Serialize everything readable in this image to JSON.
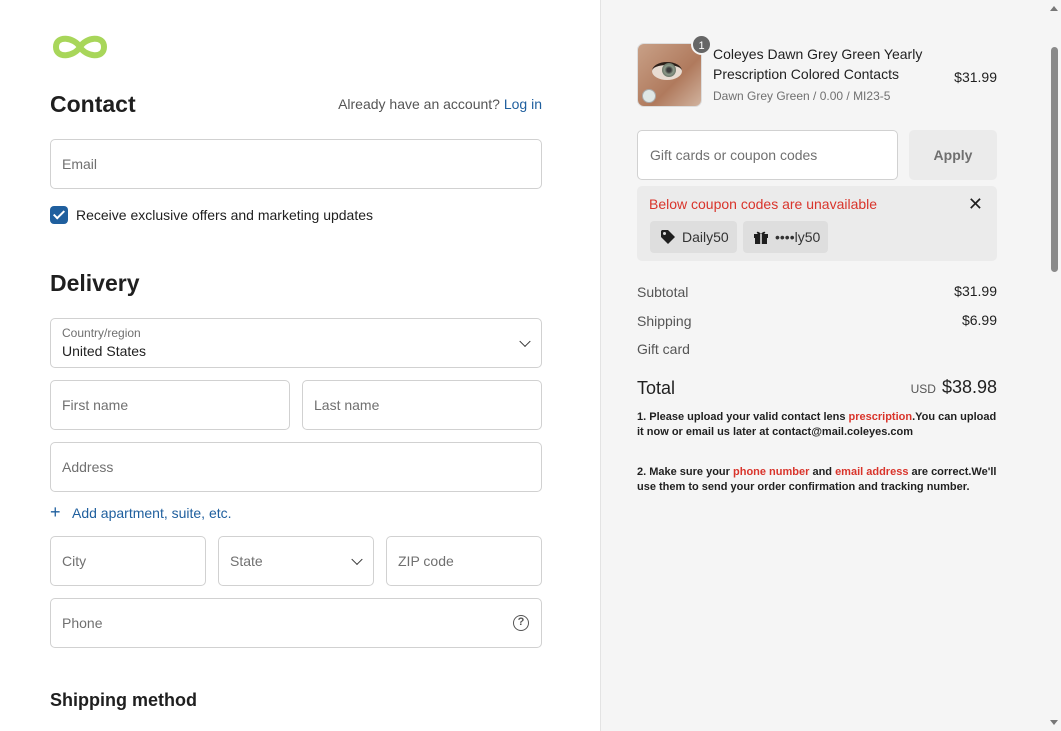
{
  "contact": {
    "heading": "Contact",
    "account_prompt": "Already have an account?",
    "login_link": "Log in",
    "email_placeholder": "Email",
    "marketing_checked": true,
    "marketing_label": "Receive exclusive offers and marketing updates"
  },
  "delivery": {
    "heading": "Delivery",
    "country_label": "Country/region",
    "country_value": "United States",
    "first_name_placeholder": "First name",
    "last_name_placeholder": "Last name",
    "address_placeholder": "Address",
    "add_apartment": "Add apartment, suite, etc.",
    "city_placeholder": "City",
    "state_placeholder": "State",
    "zip_placeholder": "ZIP code",
    "phone_placeholder": "Phone"
  },
  "shipping_method": {
    "heading": "Shipping method"
  },
  "cart": {
    "item": {
      "quantity": "1",
      "title": "Coleyes Dawn Grey Green Yearly Prescription Colored Contacts",
      "variant": "Dawn Grey Green / 0.00 / MI23-5",
      "price": "$31.99"
    },
    "coupon_placeholder": "Gift cards or coupon codes",
    "apply_label": "Apply",
    "alert": {
      "message": "Below coupon codes are unavailable",
      "codes": [
        "Daily50",
        "••••ly50"
      ]
    },
    "summary": {
      "subtotal_label": "Subtotal",
      "subtotal_value": "$31.99",
      "shipping_label": "Shipping",
      "shipping_value": "$6.99",
      "gift_card_label": "Gift card",
      "total_label": "Total",
      "currency": "USD",
      "total_value": "$38.98"
    },
    "notes": {
      "n1_a": "1. Please upload your valid contact lens ",
      "n1_red": "prescription",
      "n1_b": ".You can upload it now or email us later at contact@mail.coleyes.com",
      "n2_a": "2. Make sure your ",
      "n2_red1": "phone number",
      "n2_b": " and ",
      "n2_red2": "email address",
      "n2_c": " are correct.We'll use them to send your order confirmation and tracking number."
    }
  },
  "colors": {
    "accent": "#1f5f9e",
    "logo": "#a8d65a",
    "error": "#d9342b"
  }
}
